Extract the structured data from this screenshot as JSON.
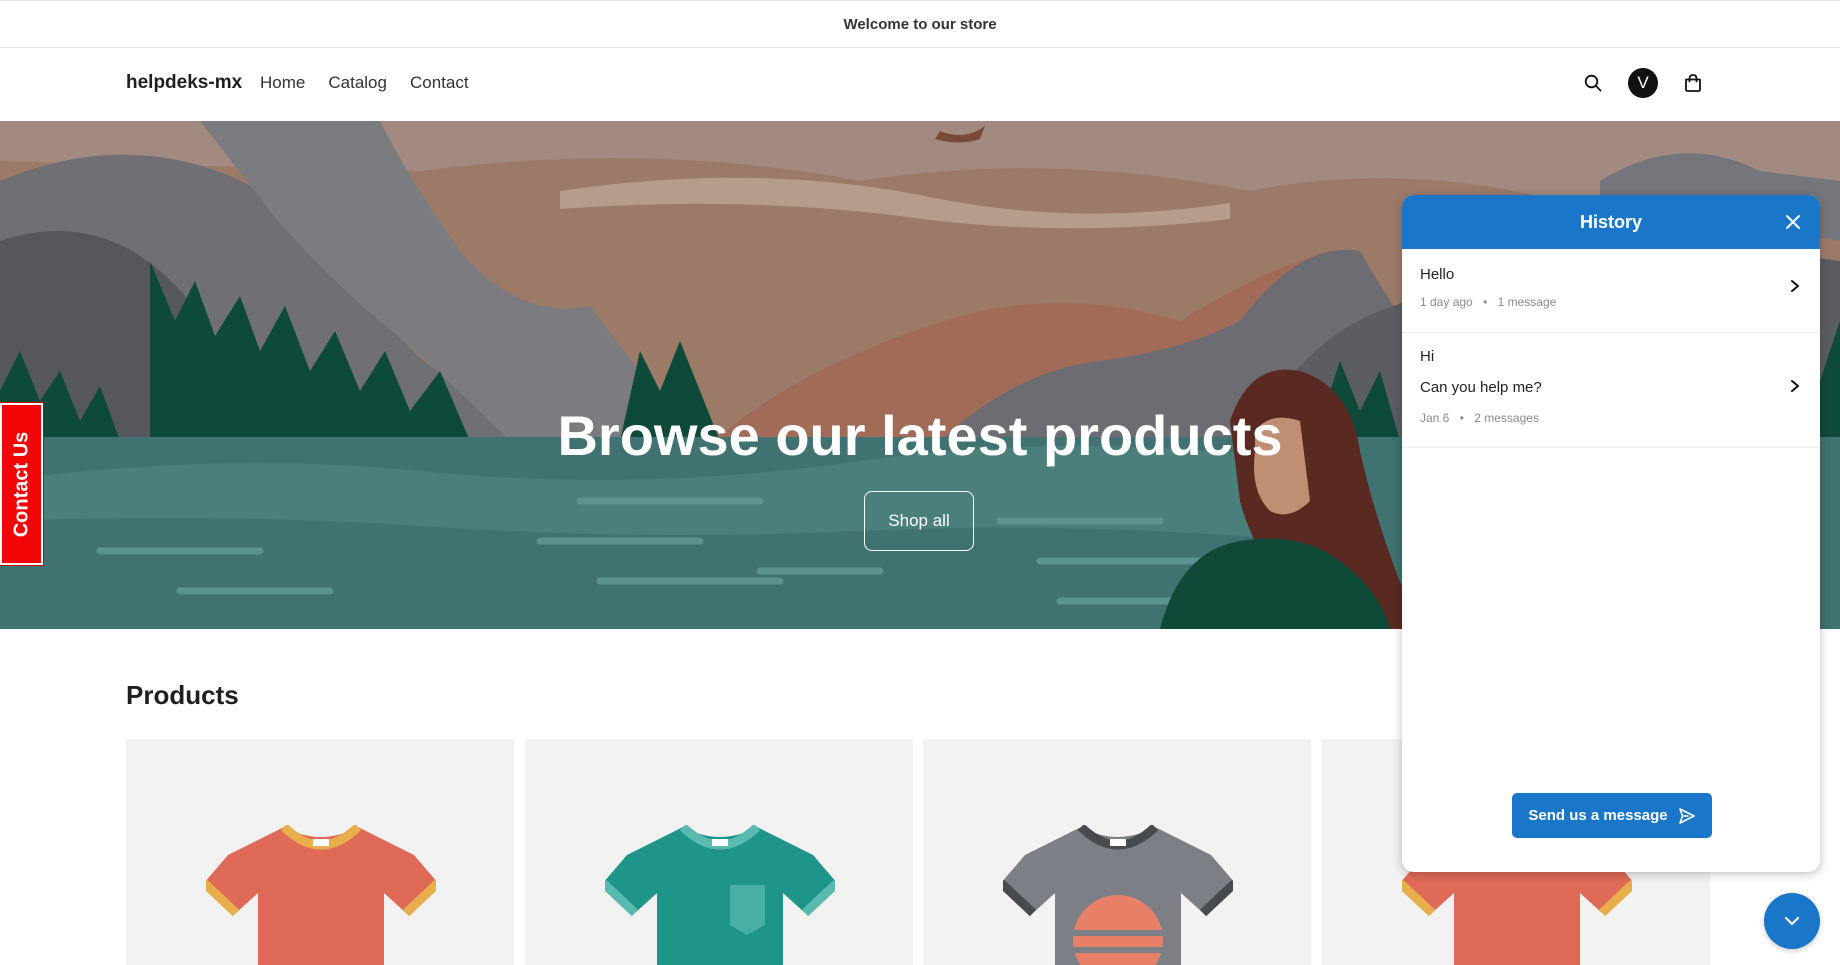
{
  "announcement": "Welcome to our store",
  "header": {
    "brand": "helpdeks-mx",
    "nav": [
      "Home",
      "Catalog",
      "Contact"
    ],
    "avatar_initial": "V",
    "icons": [
      "search-icon",
      "user-avatar",
      "cart-icon"
    ]
  },
  "hero": {
    "title": "Browse our latest products",
    "button": "Shop all"
  },
  "contact_tab": "Contact Us",
  "products": {
    "title": "Products",
    "cards": [
      {
        "image": "tshirt-red",
        "color": "#e06a58",
        "trim": "#e9ae4c"
      },
      {
        "image": "tshirt-teal",
        "color": "#1f9488",
        "trim": "#5bbab0"
      },
      {
        "image": "tshirt-gray",
        "color": "#7c7f86",
        "trim": "#474a4f"
      },
      {
        "image": "tshirt-red",
        "color": "#e06a58",
        "trim": "#e9ae4c"
      }
    ]
  },
  "chat": {
    "title": "History",
    "threads": [
      {
        "lines": [
          "Hello"
        ],
        "time": "1 day ago",
        "count": "1 message"
      },
      {
        "lines": [
          "Hi",
          "Can you help me?"
        ],
        "time": "Jan 6",
        "count": "2 messages"
      }
    ],
    "send_label": "Send us a message"
  },
  "colors": {
    "accent": "#1976c9",
    "contact_tab": "#f20505"
  }
}
